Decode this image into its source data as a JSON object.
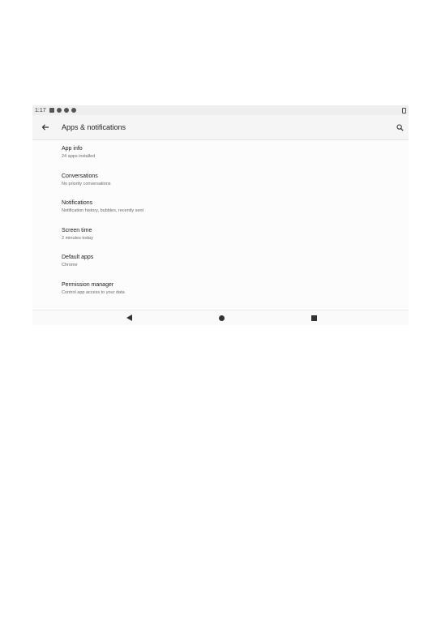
{
  "status_bar": {
    "time": "1:17",
    "icons": [
      "sim-icon",
      "notification-icon",
      "settings-icon",
      "sync-icon"
    ],
    "battery_icon": "battery-icon"
  },
  "app_bar": {
    "title": "Apps & notifications",
    "back_icon": "arrow-left-icon",
    "search_icon": "search-icon"
  },
  "items": [
    {
      "title": "App info",
      "subtitle": "24 apps installed"
    },
    {
      "title": "Conversations",
      "subtitle": "No priority conversations"
    },
    {
      "title": "Notifications",
      "subtitle": "Notification history, bubbles, recently sent"
    },
    {
      "title": "Screen time",
      "subtitle": "2 minutes today"
    },
    {
      "title": "Default apps",
      "subtitle": "Chrome"
    },
    {
      "title": "Permission manager",
      "subtitle": "Control app access to your data"
    }
  ],
  "nav_bar": {
    "back": "triangle-back-icon",
    "home": "circle-home-icon",
    "recents": "square-recents-icon"
  },
  "colors": {
    "background": "#ffffff",
    "app_bar": "#f5f5f5",
    "status_bar": "#eeeeee",
    "text_primary": "#202020",
    "text_secondary": "#6b6b6b"
  }
}
